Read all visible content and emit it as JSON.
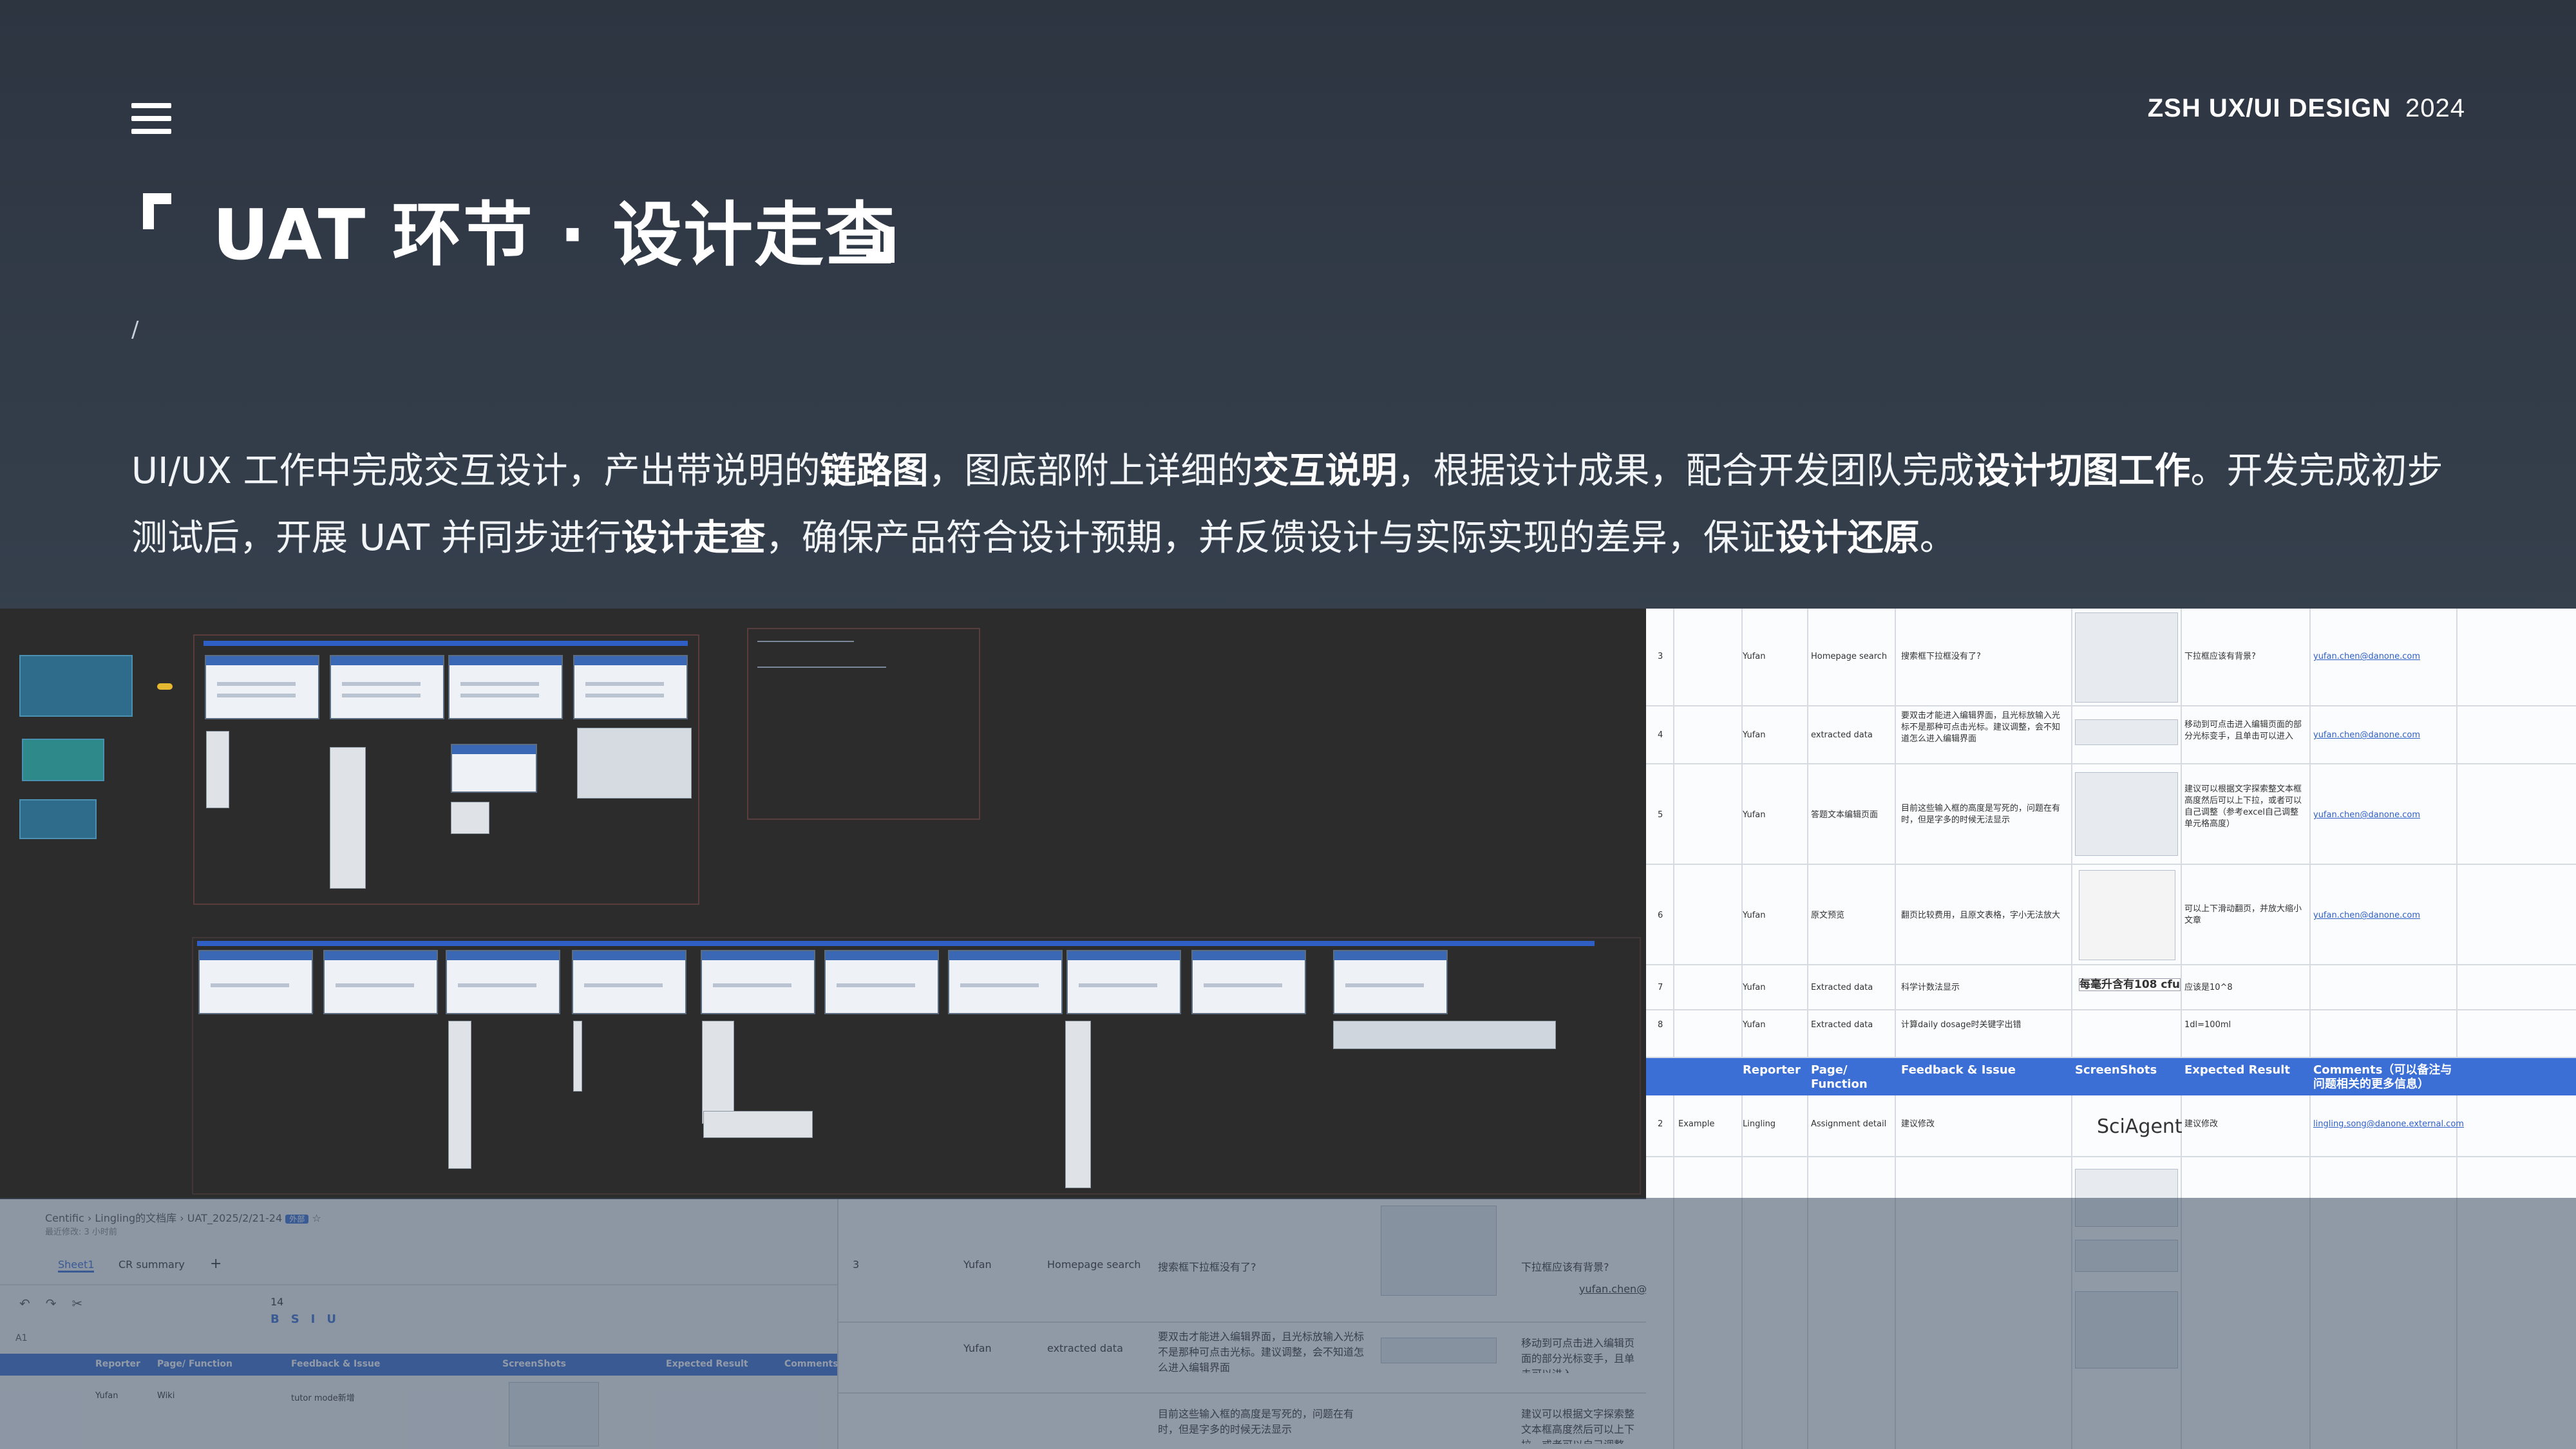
{
  "header": {
    "brand": "ZSH UX/UI DESIGN",
    "year": "2024",
    "title": "UAT 环节 · 设计走查",
    "slash": "/"
  },
  "description": {
    "p1": "UI/UX 工作中完成交互设计，产出带说明的",
    "b1": "链路图",
    "p2": "，图底部附上详细的",
    "b2": "交互说明",
    "p3": "，根据设计成果，配合开发团队完成",
    "b3": "设计切图工作",
    "p4": "。开发完成初步测试后，开展 UAT 并同步进行",
    "b4": "设计走查",
    "p5": "，确保产品符合设计预期，并反馈设计与实际实现的差异，保证",
    "b5": "设计还原",
    "p6": "。"
  },
  "sheet": {
    "header": {
      "reporter": "Reporter",
      "page": "Page/ Function",
      "feedback": "Feedback & Issue",
      "screenshots": "ScreenShots",
      "expected": "Expected Result",
      "comments": "Comments（可以备注与问题相关的更多信息）"
    },
    "rows": [
      {
        "no": "3",
        "reporter": "Yufan",
        "page": "Homepage search",
        "issue": "搜索框下拉框没有了?",
        "expected": "下拉框应该有背景?",
        "email": "yufan.chen@danone.com"
      },
      {
        "no": "4",
        "reporter": "Yufan",
        "page": "extracted data",
        "issue": "要双击才能进入编辑界面，且光标放输入光标不是那种可点击光标。建议调整，会不知道怎么进入编辑界面",
        "expected": "移动到可点击进入编辑页面的部分光标变手，且单击可以进入",
        "email": "yufan.chen@danone.com"
      },
      {
        "no": "5",
        "reporter": "Yufan",
        "page": "答题文本编辑页面",
        "issue": "目前这些输入框的高度是写死的，问题在有时，但是字多的时候无法显示",
        "expected": "建议可以根据文字探索整文本框高度然后可以上下拉，或者可以自己调整（参考excel自己调整单元格高度）",
        "email": "yufan.chen@danone.com"
      },
      {
        "no": "6",
        "reporter": "Yufan",
        "page": "原文预览",
        "issue": "翻页比较费用，且原文表格，字小无法放大",
        "expected": "可以上下滑动翻页，并放大缩小文章",
        "email": "yufan.chen@danone.com"
      },
      {
        "no": "7",
        "reporter": "Yufan",
        "page": "Extracted data",
        "issue": "科学计数法显示",
        "shot": "每毫升含有108 cfu",
        "expected": "应该是10^8"
      },
      {
        "no": "8",
        "reporter": "Yufan",
        "page": "Extracted data",
        "issue": "计算daily dosage时关键字出错",
        "expected": "1dl=100ml"
      },
      {
        "no": "2",
        "reporter": "Example",
        "page": "Lingling",
        "fn": "Assignment detail",
        "issue": "建议修改",
        "shot": "SciAgent",
        "expected": "建议修改",
        "email": "lingling.song@danone.external.com"
      }
    ]
  },
  "workbook": {
    "breadcrumb": [
      "Centific",
      "Lingling的文档库",
      "UAT_2025/2/21-24"
    ],
    "badge": "外部",
    "saved": "最近修改: 3 小时前",
    "sheets": [
      "Sheet1",
      "CR summary"
    ],
    "font_size": "14",
    "cell_ref": "A1",
    "headers": [
      "Reporter",
      "Page/ Function",
      "Feedback & Issue",
      "ScreenShots",
      "Expected Result",
      "Comments"
    ],
    "example_row": [
      "Yufan",
      "Wiki",
      "tutor mode新增"
    ]
  },
  "colors": {
    "accent": "#3c6fd6",
    "bg": "#2d3541"
  }
}
